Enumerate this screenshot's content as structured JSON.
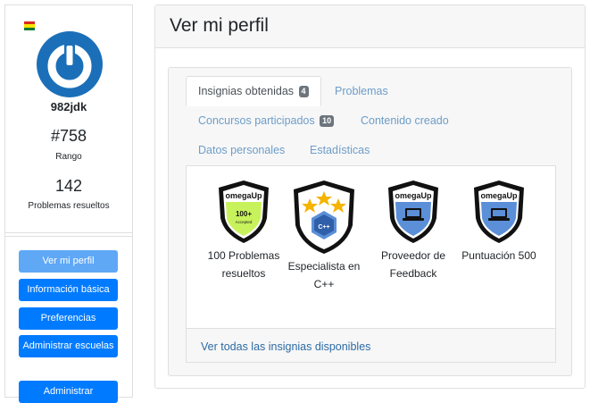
{
  "profile": {
    "username": "982jdk",
    "flag_colors": [
      "#d52b1e",
      "#f9e300",
      "#007934"
    ],
    "avatar_icon": "power-icon",
    "avatar_color": "#1b6fb8",
    "rank_value": "#758",
    "rank_label": "Rango",
    "solved_value": "142",
    "solved_label": "Problemas resueltos"
  },
  "nav": [
    {
      "label": "Ver mi perfil"
    },
    {
      "label": "Información básica"
    },
    {
      "label": "Preferencias"
    },
    {
      "label": "Administrar escuelas"
    },
    {
      "label": "Administrar"
    }
  ],
  "main": {
    "title": "Ver mi perfil",
    "tabs": [
      {
        "label": "Insignias obtenidas",
        "badge": "4"
      },
      {
        "label": "Problemas"
      },
      {
        "label": "Concursos participados",
        "badge": "10"
      },
      {
        "label": "Contenido creado"
      },
      {
        "label": "Datos personales"
      },
      {
        "label": "Estadísticas"
      }
    ],
    "badges": [
      {
        "name": "100 Problemas resueltos",
        "brand": "omegaUp",
        "text": "100+",
        "subtext": "Accepted",
        "color": "#c8f25c"
      },
      {
        "name": "Especialista en C++",
        "brand": "",
        "text": "C++",
        "subtext": "",
        "color": "#ffffff"
      },
      {
        "name": "Proveedor de Feedback",
        "brand": "omegaUp",
        "text": "",
        "subtext": "",
        "color": "#5b8fd8"
      },
      {
        "name": "Puntuación 500",
        "brand": "omegaUp",
        "text": "",
        "subtext": "",
        "color": "#5b8fd8"
      }
    ],
    "footer_link": "Ver todas las insignias disponibles"
  }
}
